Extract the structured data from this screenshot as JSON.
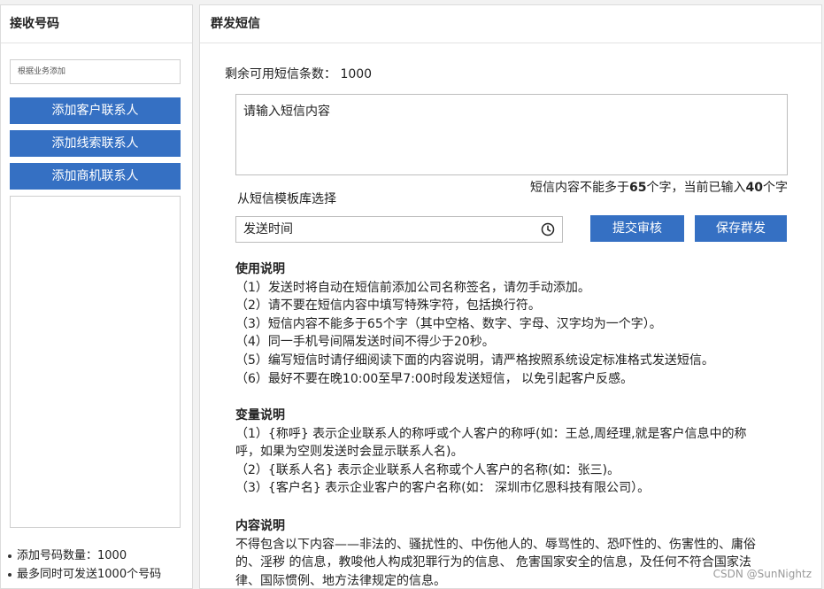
{
  "left": {
    "title": "接收号码",
    "search_placeholder": "根据业务添加",
    "buttons": [
      "添加客户联系人",
      "添加线索联系人",
      "添加商机联系人"
    ],
    "notes": [
      "添加号码数量：1000",
      "最多同时可发送1000个号码"
    ]
  },
  "right": {
    "title": "群发短信",
    "remaining": "剩余可用短信条数： 1000",
    "sms_placeholder": "请输入短信内容",
    "template_link": "从短信模板库选择",
    "limit_prefix": "短信内容不能多于",
    "limit_max": "65",
    "limit_mid": "个字，当前已输入",
    "limit_current": "40",
    "limit_suffix": "个字",
    "time_placeholder": "发送时间",
    "submit_label": "提交审核",
    "save_label": "保存群发",
    "usage": {
      "title": "使用说明",
      "items": [
        "（1）发送时将自动在短信前添加公司名称签名，请勿手动添加。",
        "（2）请不要在短信内容中填写特殊字符，包括换行符。",
        "（3）短信内容不能多于65个字（其中空格、数字、字母、汉字均为一个字）。",
        "（4）同一手机号间隔发送时间不得少于20秒。",
        "（5）编写短信时请仔细阅读下面的内容说明，请严格按照系统设定标准格式发送短信。",
        "（6）最好不要在晚10:00至早7:00时段发送短信， 以免引起客户反感。"
      ]
    },
    "variables": {
      "title": "变量说明",
      "items": [
        "（1）{称呼} 表示企业联系人的称呼或个人客户的称呼(如：王总,周经理,就是客户信息中的称呼，如果为空则发送时会显示联系人名)。",
        "（2）{联系人名} 表示企业联系人名称或个人客户的名称(如：张三)。",
        "（3）{客户名} 表示企业客户的客户名称(如： 深圳市亿恩科技有限公司）。"
      ]
    },
    "content": {
      "title": "内容说明",
      "text": "不得包含以下内容——非法的、骚扰性的、中伤他人的、辱骂性的、恐吓性的、伤害性的、庸俗的、淫秽 的信息，教唆他人构成犯罪行为的信息、 危害国家安全的信息，及任何不符合国家法律、国际惯例、地方法律规定的信息。"
    }
  },
  "watermark": "CSDN @SunNightz"
}
